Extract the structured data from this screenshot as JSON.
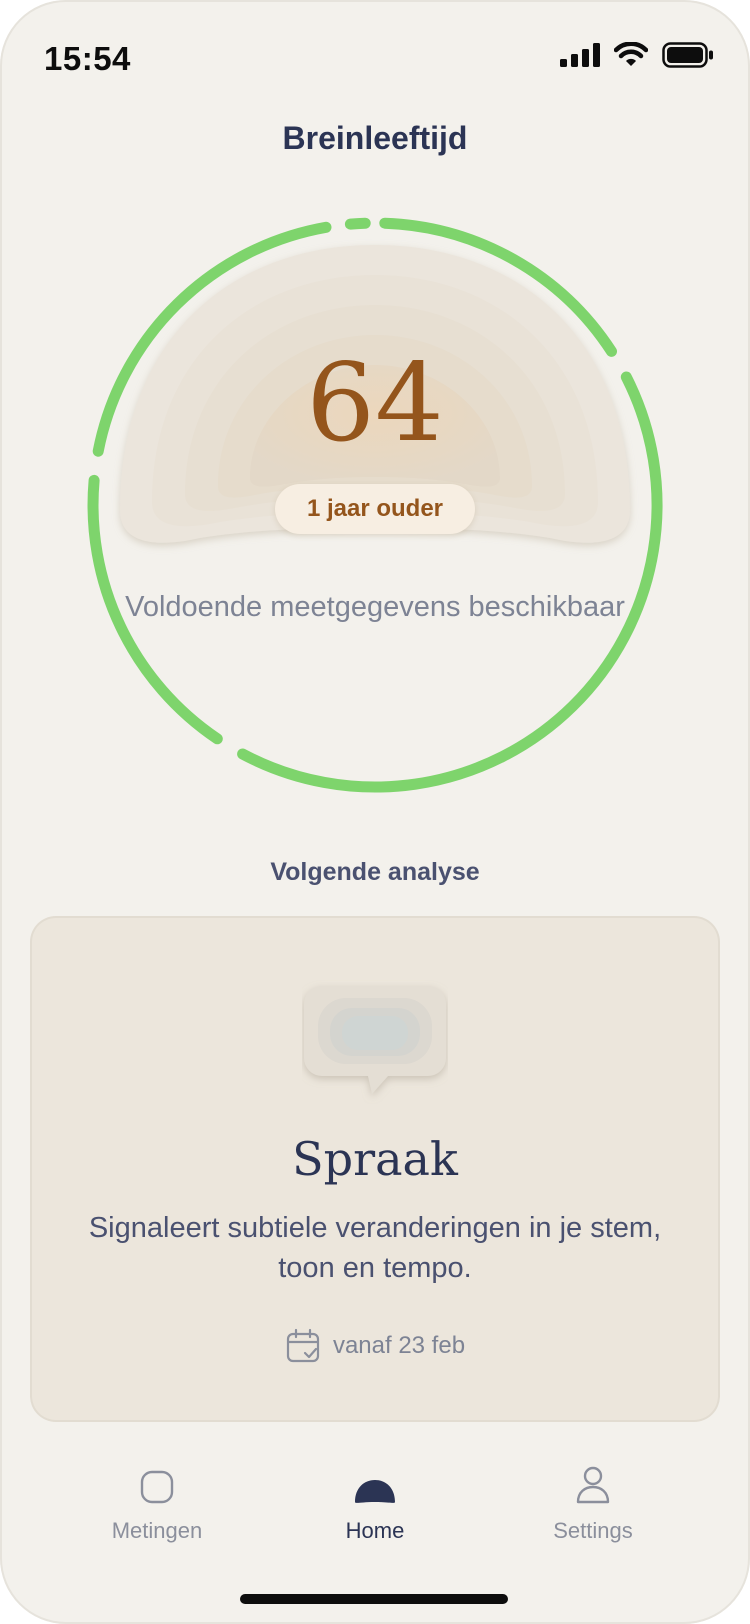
{
  "status_bar": {
    "time": "15:54"
  },
  "page": {
    "title": "Breinleeftijd"
  },
  "brain_age": {
    "value": "64",
    "difference": "1 jaar ouder",
    "status": "Voldoende meetgegevens beschikbaar",
    "ring_color": "#7ed46c",
    "value_color": "#94551c"
  },
  "next_analysis": {
    "section_label": "Volgende analyse",
    "title": "Spraak",
    "description": "Signaleert subtiele veranderingen in je stem, toon en tempo.",
    "date": "vanaf 23 feb",
    "icon": "speech-bubble-icon"
  },
  "tabs": [
    {
      "label": "Metingen",
      "icon": "rounded-square-icon",
      "active": false
    },
    {
      "label": "Home",
      "icon": "dome-icon",
      "active": true
    },
    {
      "label": "Settings",
      "icon": "person-icon",
      "active": false
    }
  ],
  "colors": {
    "background": "#f3f1ec",
    "card": "#ece6dc",
    "navy": "#2b3454",
    "muted": "#7d8394"
  }
}
